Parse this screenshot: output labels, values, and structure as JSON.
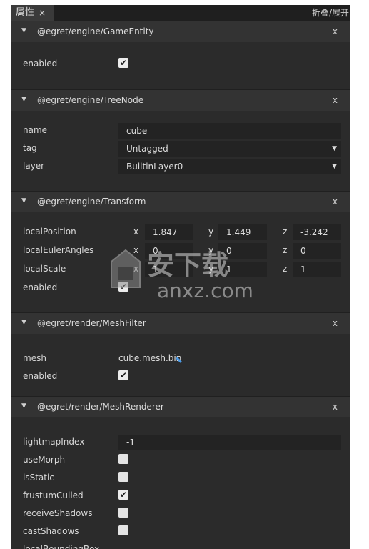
{
  "tabbar": {
    "tab_label": "属性",
    "tab_close": "×",
    "collapse_all": "折叠/展开"
  },
  "watermark": {
    "text": "安下载",
    "domain": "anxz.com"
  },
  "sections": {
    "gameentity": {
      "title": "@egret/engine/GameEntity",
      "close": "x",
      "enabled_label": "enabled",
      "enabled": "✔"
    },
    "treenode": {
      "title": "@egret/engine/TreeNode",
      "close": "x",
      "name_label": "name",
      "name_value": "cube",
      "tag_label": "tag",
      "tag_value": "Untagged",
      "layer_label": "layer",
      "layer_value": "BuiltinLayer0",
      "dropdown_arrow": "▼"
    },
    "transform": {
      "title": "@egret/engine/Transform",
      "close": "x",
      "pos_label": "localPosition",
      "pos": {
        "x": "1.847",
        "y": "1.449",
        "z": "-3.242"
      },
      "euler_label": "localEulerAngles",
      "euler": {
        "x": "0",
        "y": "0",
        "z": "0"
      },
      "scale_label": "localScale",
      "scale": {
        "x": "1",
        "y": "1",
        "z": "1"
      },
      "axis": {
        "x": "x",
        "y": "y",
        "z": "z"
      },
      "enabled_label": "enabled",
      "enabled": "✔"
    },
    "meshfilter": {
      "title": "@egret/render/MeshFilter",
      "close": "x",
      "mesh_label": "mesh",
      "mesh_value": "cube.mesh.bin",
      "enabled_label": "enabled",
      "enabled": "✔"
    },
    "meshrenderer": {
      "title": "@egret/render/MeshRenderer",
      "close": "x",
      "lightmap_label": "lightmapIndex",
      "lightmap_value": "-1",
      "usemorph_label": "useMorph",
      "isstatic_label": "isStatic",
      "frustum_label": "frustumCulled",
      "frustum": "✔",
      "receive_label": "receiveShadows",
      "cast_label": "castShadows",
      "bbox_label": "localBoundingBox"
    }
  },
  "chevron": "⌄"
}
